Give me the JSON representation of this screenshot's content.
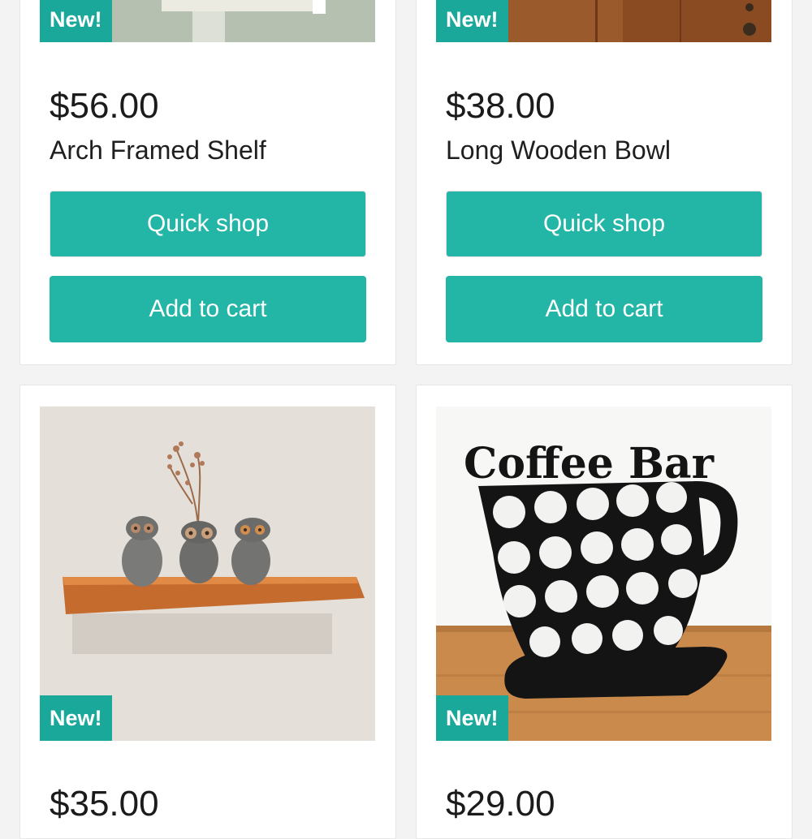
{
  "colors": {
    "accent": "#23b5a5",
    "badge": "#1aa89b",
    "page_bg": "#f3f3f3"
  },
  "products": [
    {
      "badge": "New!",
      "price": "$56.00",
      "title": "Arch Framed Shelf",
      "quick_shop": "Quick shop",
      "add_to_cart": "Add to cart"
    },
    {
      "badge": "New!",
      "price": "$38.00",
      "title": "Long Wooden Bowl",
      "quick_shop": "Quick shop",
      "add_to_cart": "Add to cart"
    },
    {
      "badge": "New!",
      "price": "$35.00",
      "image_text": ""
    },
    {
      "badge": "New!",
      "price": "$29.00",
      "image_text": "Coffee Bar"
    }
  ]
}
